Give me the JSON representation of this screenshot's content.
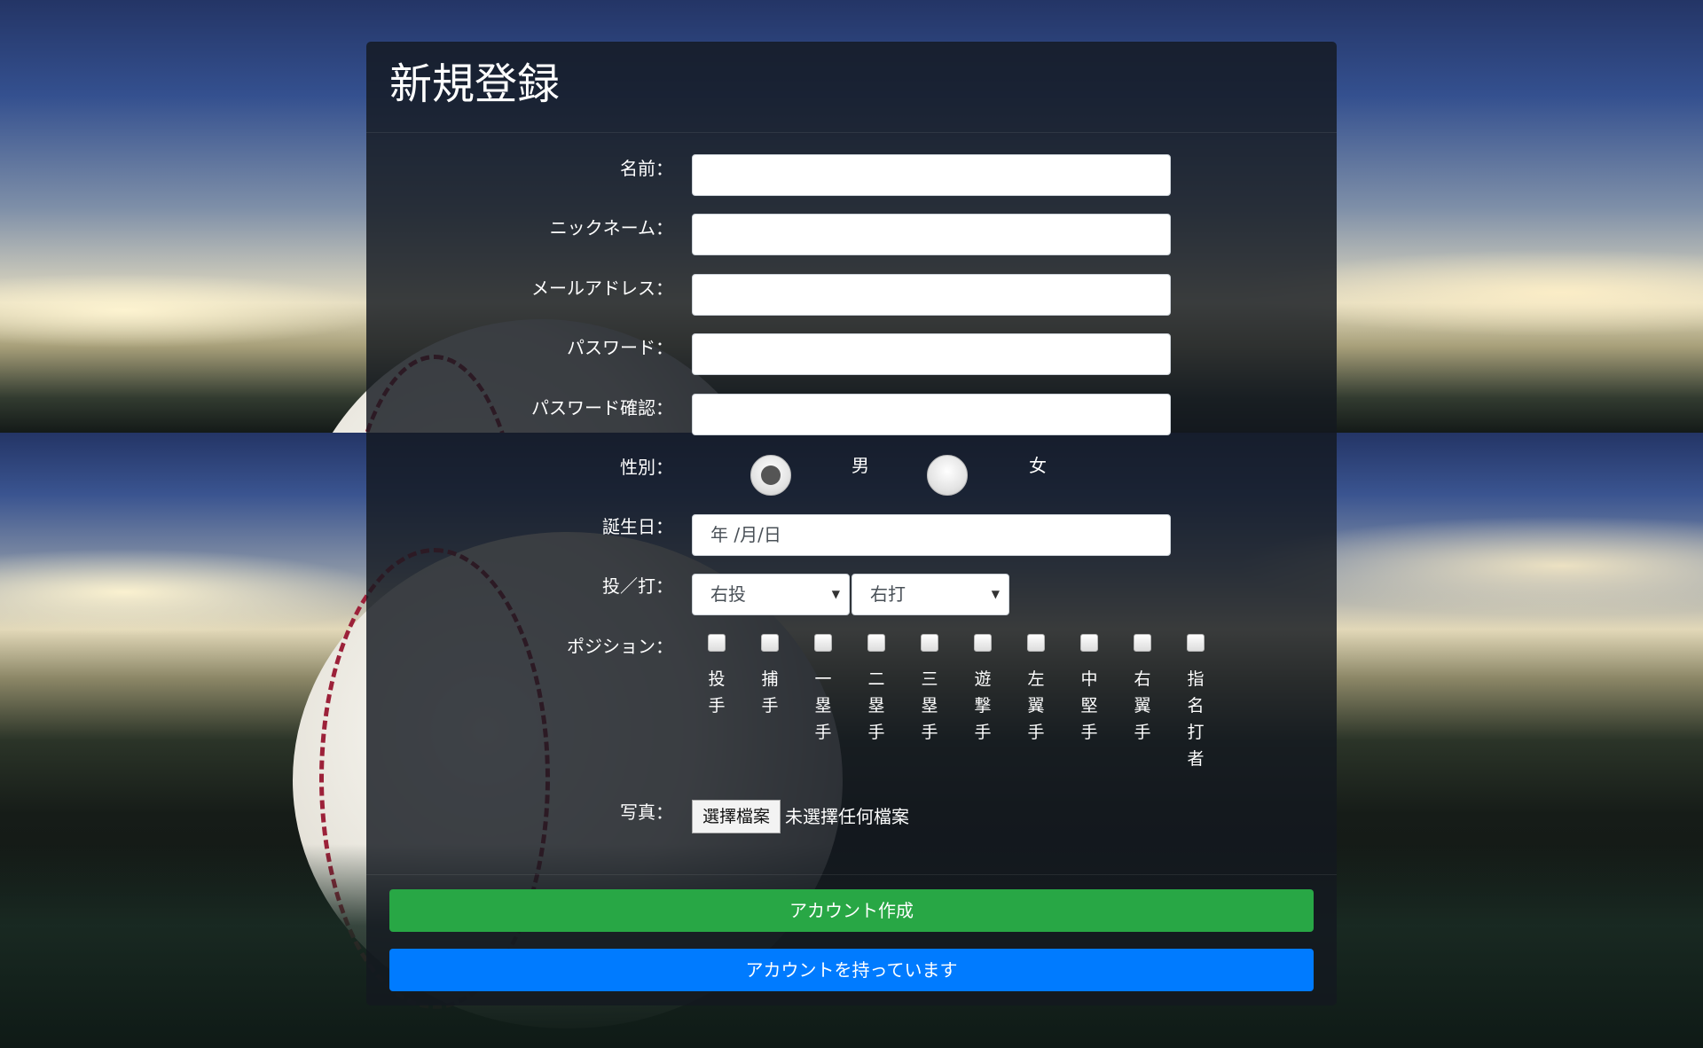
{
  "page": {
    "title": "新規登録"
  },
  "fields": {
    "name_label": "名前：",
    "nickname_label": "ニックネーム：",
    "email_label": "メールアドレス：",
    "password_label": "パスワード：",
    "password_confirm_label": "パスワード確認：",
    "gender_label": "性別：",
    "gender_options": [
      "男",
      "女"
    ],
    "gender_selected": "男",
    "birthday_label": "誕生日：",
    "birthday_placeholder": "年 /月/日",
    "throw_bat_label": "投／打：",
    "throw_value": "右投",
    "bat_value": "右打",
    "position_label": "ポジション：",
    "positions": [
      "投手",
      "捕手",
      "一塁手",
      "二塁手",
      "三塁手",
      "遊撃手",
      "左翼手",
      "中堅手",
      "右翼手",
      "指名打者"
    ],
    "photo_label": "写真：",
    "photo_button": "選擇檔案",
    "photo_status": "未選擇任何檔案"
  },
  "actions": {
    "create_account": "アカウント作成",
    "have_account": "アカウントを持っています"
  },
  "colors": {
    "create_button": "#28a745",
    "login_button": "#007bff"
  }
}
